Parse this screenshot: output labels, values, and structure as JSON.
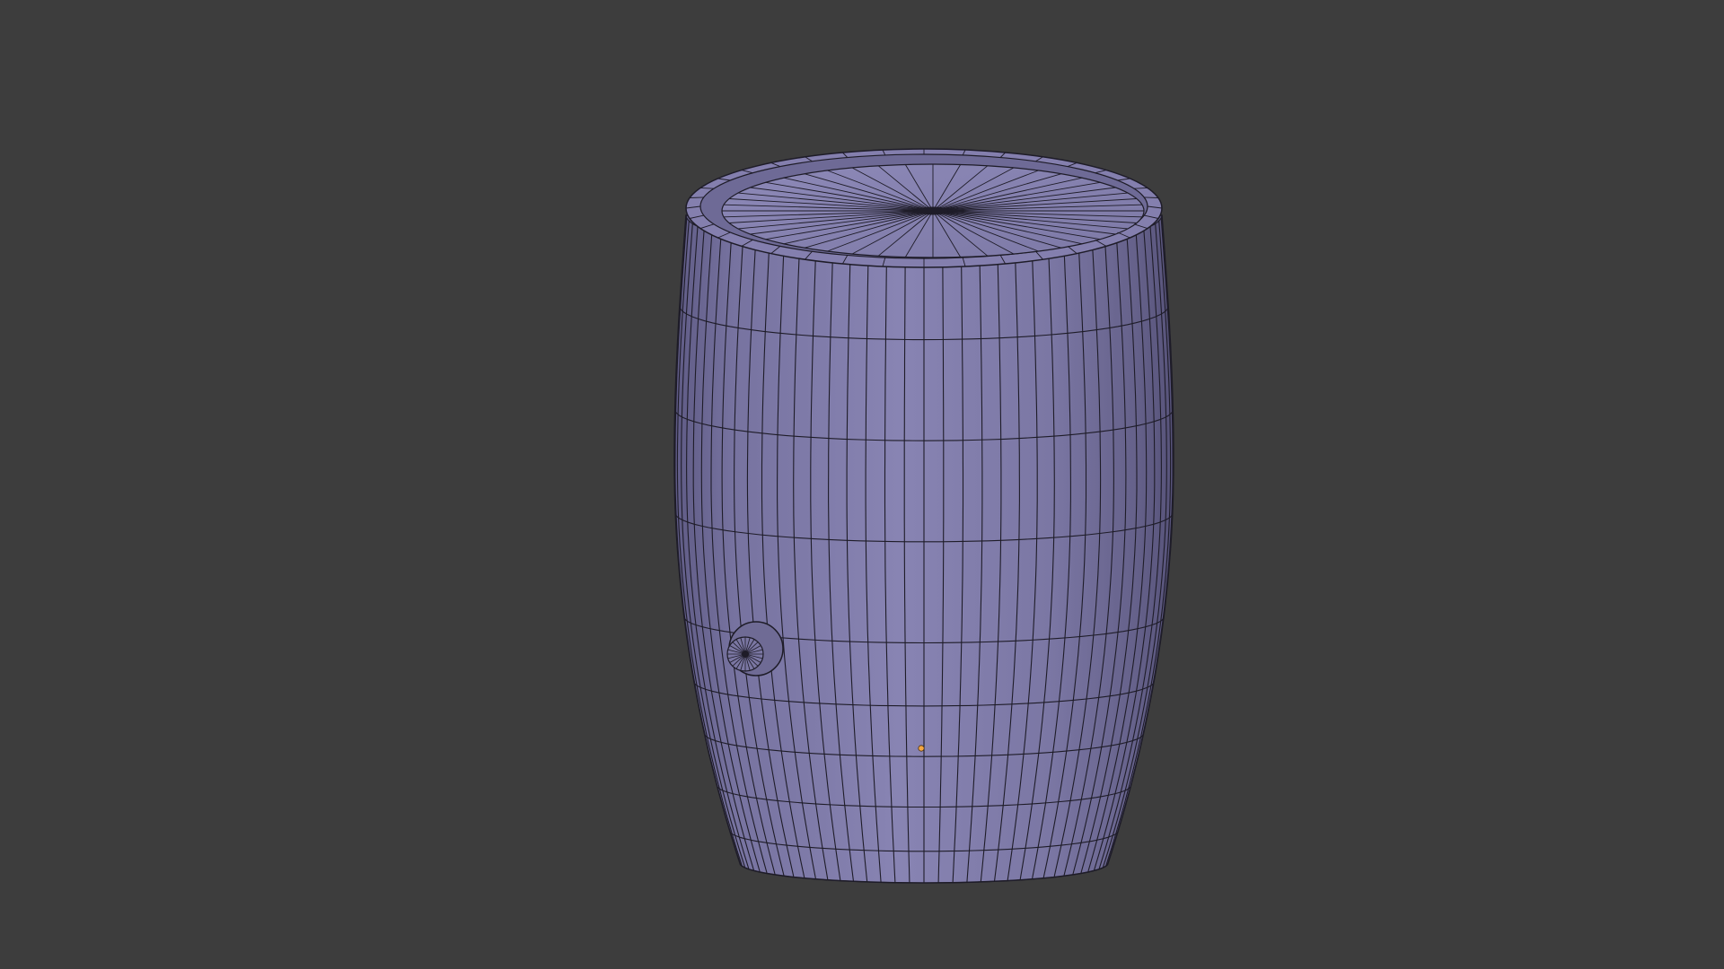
{
  "app": {
    "view": "3D Viewport",
    "shading": "solid-wireframe"
  },
  "scene": {
    "object": "barrel",
    "object_color": "#7f7aa8",
    "wire_color": "#1e1c28",
    "background_color": "#3d3d3d",
    "origin_color": "#f5a742",
    "icons": {
      "origin": "object-origin-icon",
      "tap": "barrel-tap-icon"
    }
  }
}
